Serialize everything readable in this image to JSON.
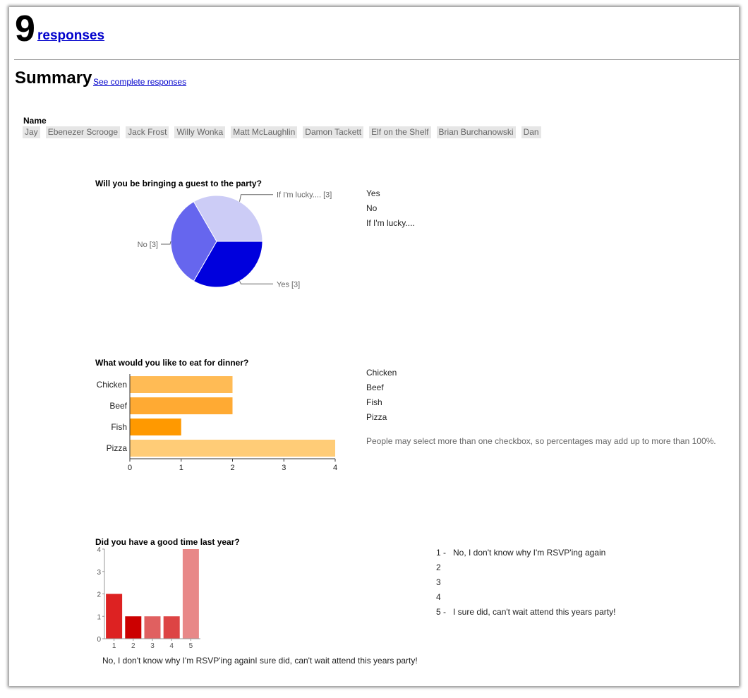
{
  "header": {
    "count": "9",
    "count_label": "responses"
  },
  "summary": {
    "title": "Summary",
    "link": "See complete responses"
  },
  "name_question": {
    "label": "Name",
    "values": [
      "Jay",
      "Ebenezer Scrooge",
      "Jack Frost",
      "Willy Wonka",
      "Matt McLaughlin",
      "Damon Tackett ",
      "Elf on the Shelf",
      "Brian Burchanowski",
      "Dan"
    ]
  },
  "q1": {
    "title": "Will you be bringing a guest to the party?",
    "legend": [
      "Yes",
      "No",
      "If I'm lucky...."
    ]
  },
  "q2": {
    "title": "What would you like to eat for dinner?",
    "legend": [
      "Chicken",
      "Beef",
      "Fish",
      "Pizza"
    ],
    "note": "People may select more than one checkbox, so percentages may add up to more than 100%."
  },
  "q3": {
    "title": "Did you have a good time last year?",
    "scale": [
      {
        "num": "1 -",
        "label": "No, I don't know why I'm RSVP'ing again"
      },
      {
        "num": "2",
        "label": ""
      },
      {
        "num": "3",
        "label": ""
      },
      {
        "num": "4",
        "label": ""
      },
      {
        "num": "5 -",
        "label": "I sure did, can't wait attend this years party!"
      }
    ],
    "bottom_text": "No, I don't know why I'm RSVP'ing againI sure did, can't wait attend this years party!"
  },
  "chart_data": [
    {
      "type": "pie",
      "title": "Will you be bringing a guest to the party?",
      "categories": [
        "Yes",
        "No",
        "If I'm lucky...."
      ],
      "values": [
        3,
        3,
        3
      ],
      "slice_labels": [
        "Yes [3]",
        "No [3]",
        "If I'm lucky.... [3]"
      ],
      "colors": [
        "#0000dd",
        "#6666ee",
        "#ccccf6"
      ]
    },
    {
      "type": "bar",
      "orientation": "horizontal",
      "title": "What would you like to eat for dinner?",
      "categories": [
        "Chicken",
        "Beef",
        "Fish",
        "Pizza"
      ],
      "values": [
        2,
        2,
        1,
        4
      ],
      "xlim": [
        0,
        4
      ],
      "ticks": [
        "0",
        "1",
        "2",
        "3",
        "4"
      ],
      "colors": [
        "#ffbb55",
        "#ffaa33",
        "#ff9900",
        "#ffcc77"
      ]
    },
    {
      "type": "bar",
      "orientation": "vertical",
      "title": "Did you have a good time last year?",
      "categories": [
        "1",
        "2",
        "3",
        "4",
        "5"
      ],
      "values": [
        2,
        1,
        1,
        1,
        4
      ],
      "ylim": [
        0,
        4
      ],
      "ticks": [
        "0",
        "1",
        "2",
        "3",
        "4"
      ],
      "colors": [
        "#dd2222",
        "#cc0000",
        "#e06060",
        "#dd4444",
        "#e88888"
      ]
    }
  ]
}
